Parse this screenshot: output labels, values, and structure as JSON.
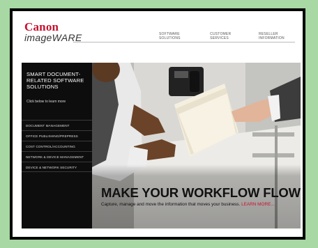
{
  "brand": {
    "name": "Canon",
    "product": "imageWARE"
  },
  "topnav": [
    "SOFTWARE SOLUTIONS",
    "CUSTOMER SERVICES",
    "RESELLER INFORMATION"
  ],
  "sidebar": {
    "title": "SMART DOCUMENT-RELATED SOFTWARE SOLUTIONS",
    "subtitle": "Click below to learn more",
    "items": [
      "DOCUMENT MANAGEMENT",
      "OFFICE PUBLISHING/PREPRESS",
      "COST CONTROL/ACCOUNTING",
      "NETWORK & DEVICE MANAGEMENT",
      "DEVICE & NETWORK SECURITY"
    ]
  },
  "hero": {
    "headline": "MAKE YOUR WORKFLOW FLOW",
    "tagline": "Capture, manage and move the information that moves your business.",
    "learn_more": "LEARN MORE..."
  },
  "colors": {
    "brand_red": "#c8102e",
    "frame": "#000000",
    "background": "#a8d8a4"
  }
}
